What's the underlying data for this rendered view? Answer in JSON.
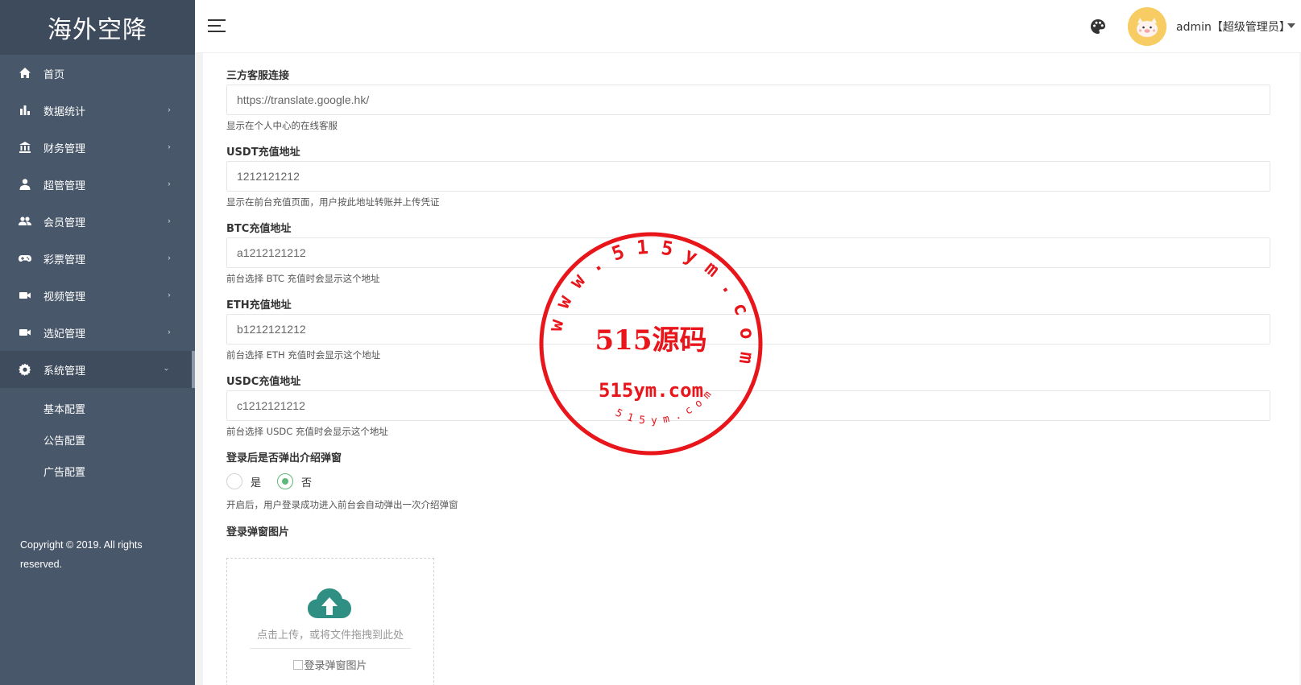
{
  "sidebar": {
    "brand": "海外空降",
    "items": [
      {
        "label": "首页",
        "icon": "home-icon",
        "has_children": false
      },
      {
        "label": "数据统计",
        "icon": "bar-chart-icon",
        "has_children": true
      },
      {
        "label": "财务管理",
        "icon": "bank-icon",
        "has_children": true
      },
      {
        "label": "超管管理",
        "icon": "user-icon",
        "has_children": true
      },
      {
        "label": "会员管理",
        "icon": "users-icon",
        "has_children": true
      },
      {
        "label": "彩票管理",
        "icon": "gamepad-icon",
        "has_children": true
      },
      {
        "label": "视频管理",
        "icon": "video-icon",
        "has_children": true
      },
      {
        "label": "选妃管理",
        "icon": "video-icon",
        "has_children": true
      },
      {
        "label": "系统管理",
        "icon": "gear-icon",
        "has_children": true,
        "expanded": true
      }
    ],
    "subitems": [
      "基本配置",
      "公告配置",
      "广告配置"
    ],
    "copyright": "Copyright © 2019. All rights reserved."
  },
  "header": {
    "user_label": "admin【超级管理员】"
  },
  "form": {
    "fields": [
      {
        "label": "三方客服连接",
        "value": "https://translate.google.hk/",
        "help": "显示在个人中心的在线客服"
      },
      {
        "label": "USDT充值地址",
        "value": "1212121212",
        "help": "显示在前台充值页面，用户按此地址转账并上传凭证"
      },
      {
        "label": "BTC充值地址",
        "value": "a1212121212",
        "help": "前台选择 BTC 充值时会显示这个地址"
      },
      {
        "label": "ETH充值地址",
        "value": "b1212121212",
        "help": "前台选择 ETH 充值时会显示这个地址"
      },
      {
        "label": "USDC充值地址",
        "value": "c1212121212",
        "help": "前台选择 USDC 充值时会显示这个地址"
      }
    ],
    "popup": {
      "label": "登录后是否弹出介绍弹窗",
      "options": [
        "是",
        "否"
      ],
      "selected": "否",
      "help": "开启后，用户登录成功进入前台会自动弹出一次介绍弹窗"
    },
    "upload": {
      "label": "登录弹窗图片",
      "hint": "点击上传，或将文件拖拽到此处",
      "image_alt": "登录弹窗图片"
    }
  },
  "watermark": {
    "ring_text": "w w w . 5 1 5 y m . c o m",
    "center_text": "515源码",
    "domain_text": "515ym.com",
    "bottom_text": "5 1 5 y m . c o m",
    "color": "#e8151b"
  },
  "colors": {
    "sidebar_bg": "#48576a",
    "brand_bg": "#3e4b5c",
    "accent_green": "#5fb878",
    "upload_icon": "#2f8f83"
  }
}
